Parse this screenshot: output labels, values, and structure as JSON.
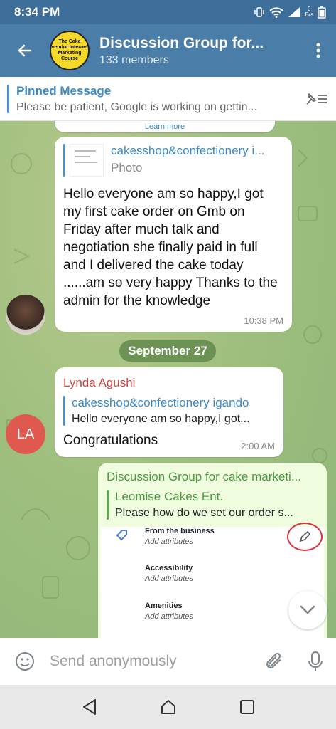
{
  "status_bar": {
    "time": "8:34 PM",
    "net_speed_top": "0",
    "net_speed_bottom": "B/s"
  },
  "header": {
    "avatar_text": "The Cake vendor Internet Marketing Course",
    "title": "Discussion Group for...",
    "subtitle": "133 members"
  },
  "pinned": {
    "title": "Pinned Message",
    "preview": "Please be patient, Google is working on gettin..."
  },
  "messages": {
    "cut_link": "Learn more",
    "msg1": {
      "reply_title": "cakesshop&confectionery i...",
      "reply_sub": "Photo",
      "text": "Hello everyone am so happy,I got my first cake order on Gmb on Friday after much talk and negotiation she finally paid in full and I delivered the cake today ......am so very happy Thanks to the admin for the knowledge",
      "time": "10:38 PM"
    },
    "date": "September 27",
    "msg2": {
      "avatar_initials": "LA",
      "sender": "Lynda Agushi",
      "quote_title": "cakesshop&confectionery igando",
      "quote_text": "Hello everyone am so happy,I got...",
      "text": "Congratulations",
      "time": "2:00 AM"
    },
    "msg3": {
      "forward_title": "Discussion Group for cake marketi...",
      "quote_title": "Leomise Cakes Ent.",
      "quote_text": "Please how do we set our order s...",
      "screenshot_rows": [
        {
          "label": "From the business",
          "sub": "Add attributes"
        },
        {
          "label": "Accessibility",
          "sub": "Add attributes"
        },
        {
          "label": "Amenities",
          "sub": "Add attributes"
        }
      ]
    }
  },
  "composer": {
    "placeholder": "Send anonymously"
  },
  "colors": {
    "header": "#4a7ea9",
    "status": "#3d6e9a",
    "accent_blue": "#3a8ac9",
    "sender_red": "#d0423a",
    "forward_green": "#4b9a42",
    "avatar_la": "#e0594f"
  }
}
